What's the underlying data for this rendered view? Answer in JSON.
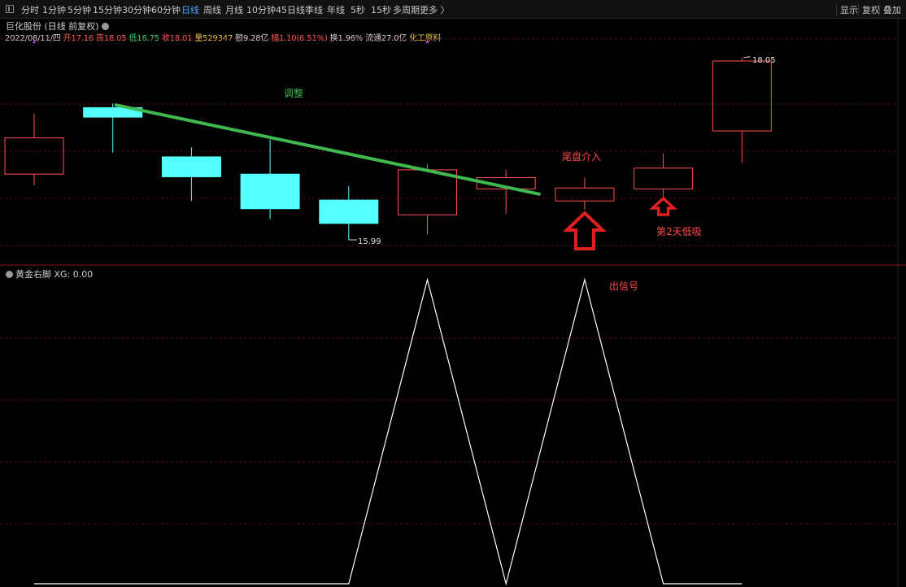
{
  "toolbar": {
    "periods": [
      "分时",
      "1分钟",
      "5分钟",
      "15分钟",
      "30分钟",
      "60分钟",
      "日线",
      "周线",
      "月线",
      "10分钟",
      "45日线",
      "季线",
      "年线",
      "5秒",
      "15秒",
      "多周期",
      "更多 〉"
    ],
    "active": "日线",
    "right_buttons": [
      "显示",
      "复权",
      "叠加"
    ]
  },
  "header": {
    "title": "巨化股份 (日线 前复权)",
    "date": "2022/08/11/四",
    "open_label": "开",
    "open": "17.16",
    "high_label": "高",
    "high": "18.05",
    "low_label": "低",
    "low": "16.75",
    "close_label": "收",
    "close": "18.01",
    "volume_label": "量",
    "volume": "529347",
    "amount_label": "额",
    "amount": "9.28亿",
    "change_label": "幅",
    "change": "1.10(6.51%)",
    "turnover_label": "换",
    "turnover": "1.96%",
    "float_label": "流通",
    "float": "27.0亿",
    "industry": "化工原料"
  },
  "indicator": {
    "name": "黄金右脚",
    "value_text": "XG: 0.00"
  },
  "annotations": {
    "adjust": "调整",
    "late_entry": "尾盘介入",
    "next_day": "第2天低吸",
    "signal": "出信号",
    "high_mark": "18.05",
    "low_mark": "15.99"
  },
  "colors": {
    "up": "#ff5050",
    "down": "#54ffff",
    "trend": "#3fb850",
    "arrow": "#e02020",
    "signal_line": "#ffffff",
    "grid": "#5a1010"
  },
  "chart_data": {
    "type": "candlestick",
    "candles": [
      {
        "open": 17.18,
        "close": 17.6,
        "high": 17.88,
        "low": 17.05
      },
      {
        "open": 17.95,
        "close": 17.84,
        "high": 18.0,
        "low": 17.43
      },
      {
        "open": 17.38,
        "close": 17.15,
        "high": 17.49,
        "low": 16.87
      },
      {
        "open": 17.18,
        "close": 16.78,
        "high": 17.58,
        "low": 16.66
      },
      {
        "open": 16.88,
        "close": 16.61,
        "high": 17.04,
        "low": 16.42
      },
      {
        "open": 16.71,
        "close": 17.23,
        "high": 17.29,
        "low": 16.48
      },
      {
        "open": 17.01,
        "close": 17.14,
        "high": 17.23,
        "low": 16.72
      },
      {
        "open": 16.87,
        "close": 17.02,
        "high": 17.14,
        "low": 16.77
      },
      {
        "open": 17.01,
        "close": 17.25,
        "high": 17.42,
        "low": 16.87
      },
      {
        "open": 17.68,
        "close": 18.49,
        "high": 18.53,
        "low": 17.31
      }
    ],
    "signal": [
      0,
      0,
      0,
      0,
      0,
      1,
      0,
      1,
      0,
      0
    ],
    "trendline": {
      "from_index": 1,
      "from_price": 17.98,
      "to_index": 6.4,
      "to_price": 16.95
    }
  }
}
